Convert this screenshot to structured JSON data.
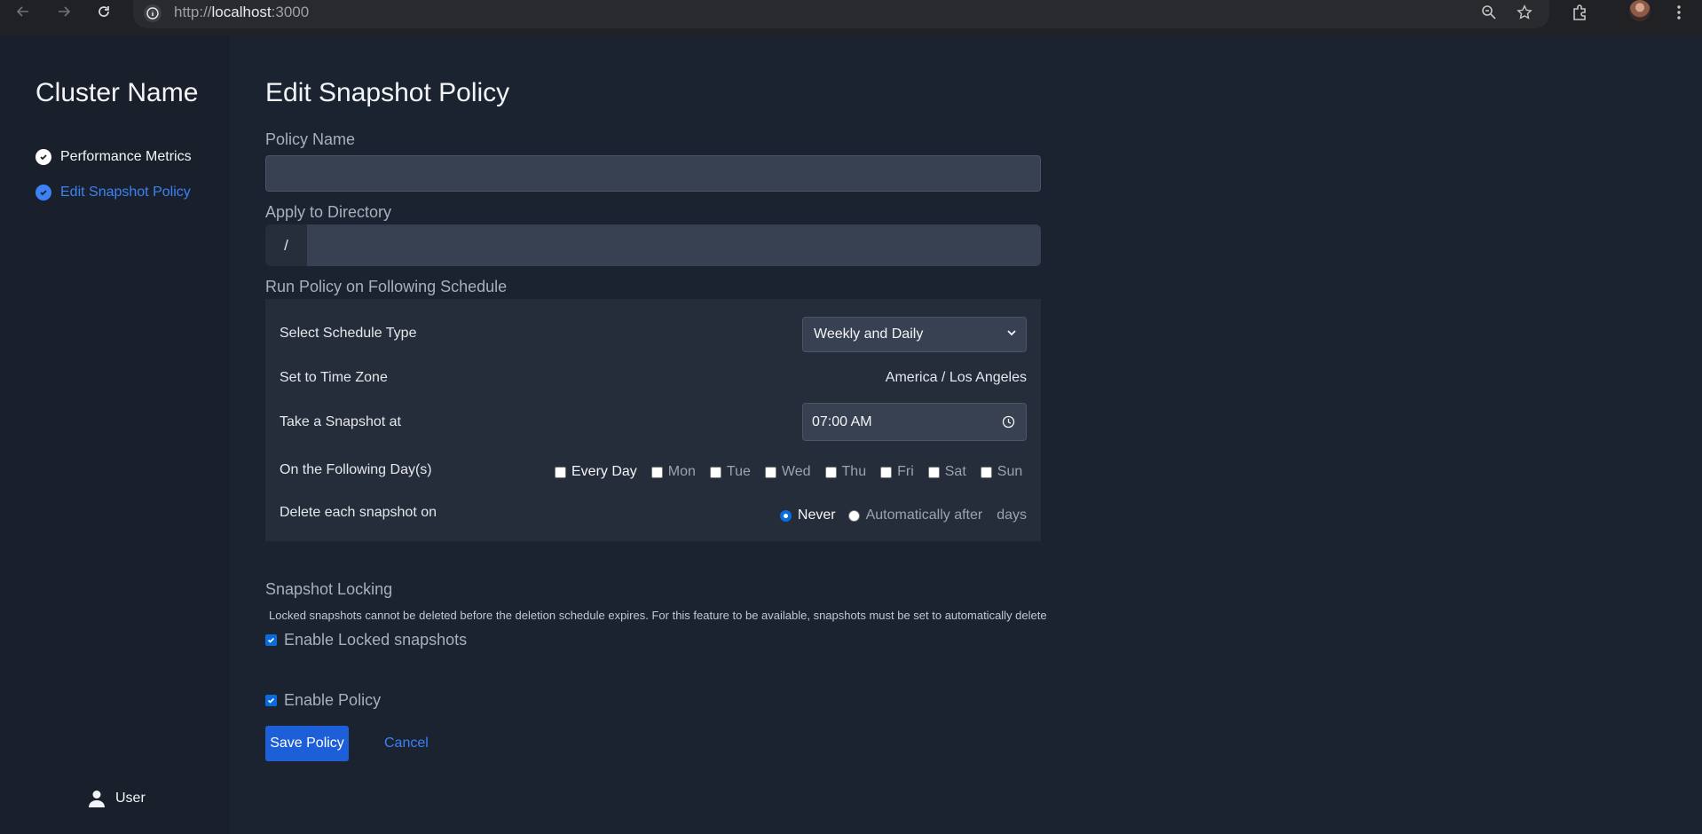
{
  "browser": {
    "url_scheme": "http://",
    "url_host": "localhost",
    "url_port": ":3000"
  },
  "sidebar": {
    "brand": "Cluster Name",
    "items": [
      {
        "label": "Performance Metrics",
        "active": false
      },
      {
        "label": "Edit Snapshot Policy",
        "active": true
      }
    ],
    "user_label": "User"
  },
  "page": {
    "title": "Edit Snapshot Policy",
    "policy_name_label": "Policy Name",
    "policy_name_value": "",
    "directory_label": "Apply to Directory",
    "directory_prefix": "/",
    "directory_value": "",
    "schedule_label": "Run Policy on Following Schedule",
    "schedule": {
      "type_label": "Select Schedule Type",
      "type_value": "Weekly and Daily",
      "timezone_label": "Set to Time Zone",
      "timezone_value": "America / Los Angeles",
      "time_label": "Take a Snapshot at",
      "time_value": "07:00 AM",
      "days_label": "On the Following Day(s)",
      "days": [
        "Every Day",
        "Mon",
        "Tue",
        "Wed",
        "Thu",
        "Fri",
        "Sat",
        "Sun"
      ],
      "delete_label": "Delete each snapshot on",
      "delete_never": "Never",
      "delete_auto": "Automatically after",
      "delete_unit": "days"
    },
    "locking_title": "Snapshot Locking",
    "locking_help": "Locked snapshots cannot be deleted before the deletion schedule expires. For this feature to be available, snapshots must be set to automatically delete",
    "locking_checkbox": "Enable Locked snapshots",
    "enable_policy_checkbox": "Enable Policy",
    "save_label": "Save Policy",
    "cancel_label": "Cancel"
  },
  "colors": {
    "accent": "#3b82f6",
    "button": "#1d5fd8",
    "background": "#1b2230",
    "panel": "#252d3b"
  }
}
